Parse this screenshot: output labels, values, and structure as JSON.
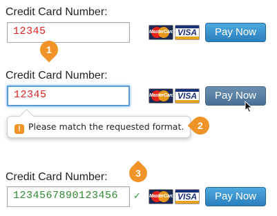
{
  "colors": {
    "invalid_text": "#e02020",
    "valid_text": "#2e8a2e",
    "button_blue": "#2a7fbe",
    "badge_orange": "#f0942a",
    "focus_ring": "#5a9bd8"
  },
  "example1": {
    "label": "Credit Card Number:",
    "value": "12345",
    "card_mastercard": "MasterCard",
    "card_visa": "VISA",
    "pay_label": "Pay Now",
    "badge": "1"
  },
  "example2": {
    "label": "Credit Card Number:",
    "value": "12345",
    "card_mastercard": "MasterCard",
    "card_visa": "VISA",
    "pay_label": "Pay Now",
    "tooltip_icon": "!",
    "tooltip_text": "Please match the requested format.",
    "badge": "2",
    "cursor_icon": "arrow-cursor-icon"
  },
  "example3": {
    "label": "Credit Card Number:",
    "value": "1234567890123456",
    "valid_mark": "✓",
    "card_mastercard": "MasterCard",
    "card_visa": "VISA",
    "pay_label": "Pay Now",
    "badge": "3"
  }
}
